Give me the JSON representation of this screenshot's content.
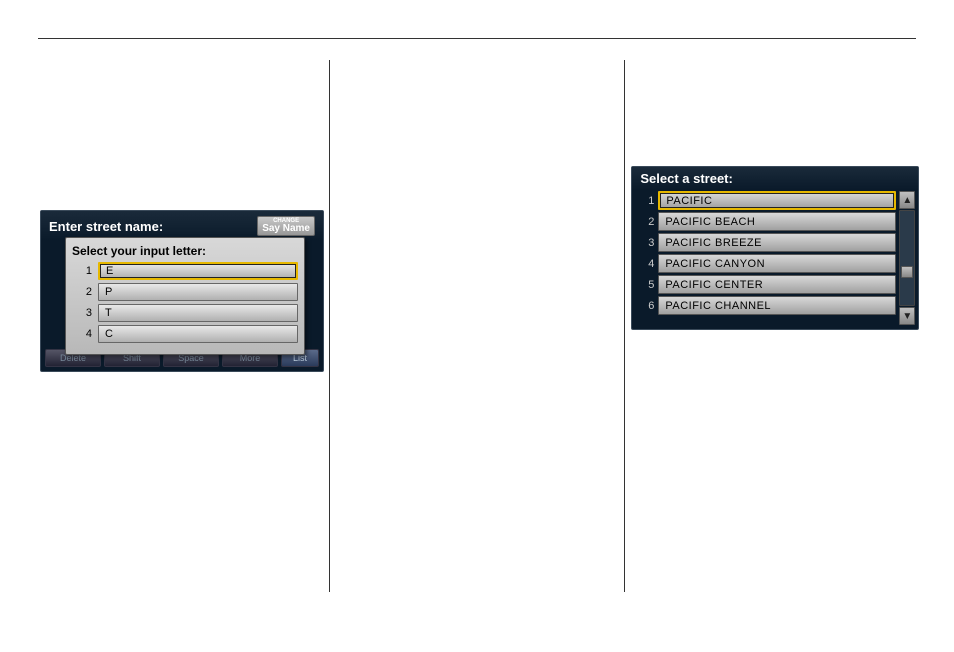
{
  "left_screen": {
    "title": "Enter street name:",
    "say_name_tiny": "CHANGE",
    "say_name_main": "Say Name",
    "popup_title": "Select your input letter:",
    "popup_rows": [
      {
        "num": "1",
        "letter": "E"
      },
      {
        "num": "2",
        "letter": "P"
      },
      {
        "num": "3",
        "letter": "T"
      },
      {
        "num": "4",
        "letter": "C"
      }
    ],
    "bottom_buttons": [
      "Delete",
      "Shift",
      "Space",
      "More",
      "List"
    ]
  },
  "right_screen": {
    "title": "Select a street:",
    "rows": [
      {
        "num": "1",
        "name": "PACIFIC"
      },
      {
        "num": "2",
        "name": "PACIFIC BEACH"
      },
      {
        "num": "3",
        "name": "PACIFIC BREEZE"
      },
      {
        "num": "4",
        "name": "PACIFIC CANYON"
      },
      {
        "num": "5",
        "name": "PACIFIC CENTER"
      },
      {
        "num": "6",
        "name": "PACIFIC CHANNEL"
      }
    ],
    "scroll_up": "▲",
    "scroll_down": "▼"
  }
}
